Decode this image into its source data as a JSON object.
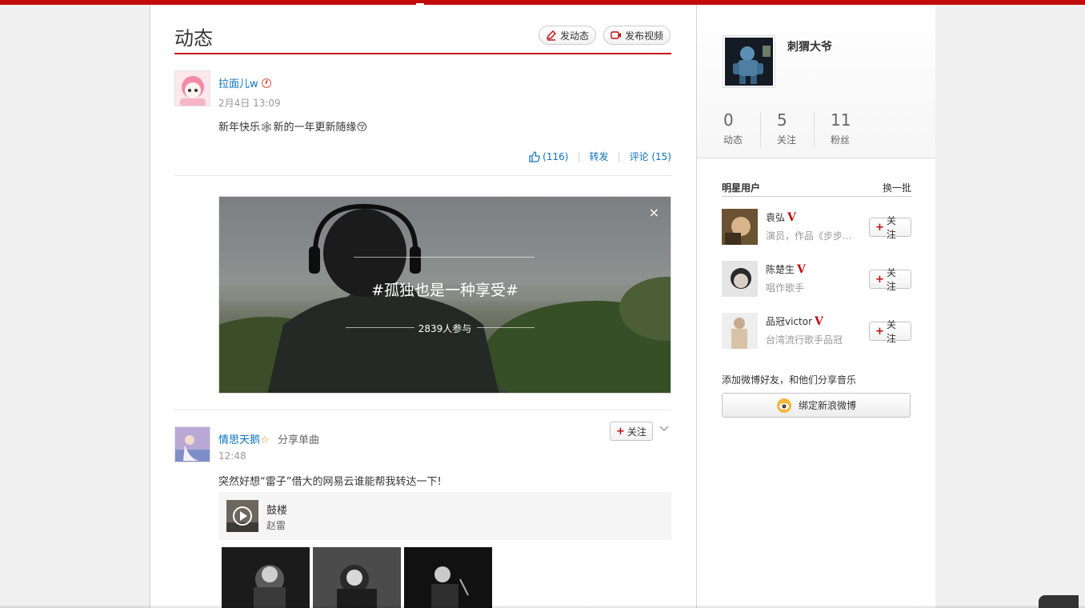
{
  "page": {
    "title": "动态",
    "post_button": "发动态",
    "video_button": "发布视频"
  },
  "feed": [
    {
      "username": "拉面儿w",
      "time": "2月4日 13:09",
      "text": "新年快乐🕸新的一年更新随缘😚",
      "like_count": "(116)",
      "forward_label": "转发",
      "comment_label": "评论 (15)"
    },
    {
      "username": "情思天鹅",
      "action": "分享单曲",
      "time": "12:48",
      "text": "突然好想“雷子”借大的网易云谁能帮我转达一下!",
      "follow_label": "关注",
      "song": {
        "name": "鼓楼",
        "artist": "赵雷"
      }
    }
  ],
  "topic": {
    "title": "#孤独也是一种享受#",
    "participants": "2839人参与",
    "close_icon": "×"
  },
  "profile": {
    "name": "刺猬大爷",
    "stats": [
      {
        "value": "0",
        "label": "动态"
      },
      {
        "value": "5",
        "label": "关注"
      },
      {
        "value": "11",
        "label": "粉丝"
      }
    ]
  },
  "star_users": {
    "title": "明星用户",
    "refresh": "换一批",
    "follow_label": "关注",
    "items": [
      {
        "name": "袁弘",
        "desc": "演员，作品《步步..."
      },
      {
        "name": "陈楚生",
        "desc": "唱作歌手"
      },
      {
        "name": "品冠victor",
        "desc": "台湾流行歌手品冠"
      }
    ]
  },
  "bind": {
    "text": "添加微博好友，和他们分享音乐",
    "button": "绑定新浪微博"
  },
  "colors": {
    "brand_red": "#c20c0c",
    "link_blue": "#0c73c2"
  }
}
